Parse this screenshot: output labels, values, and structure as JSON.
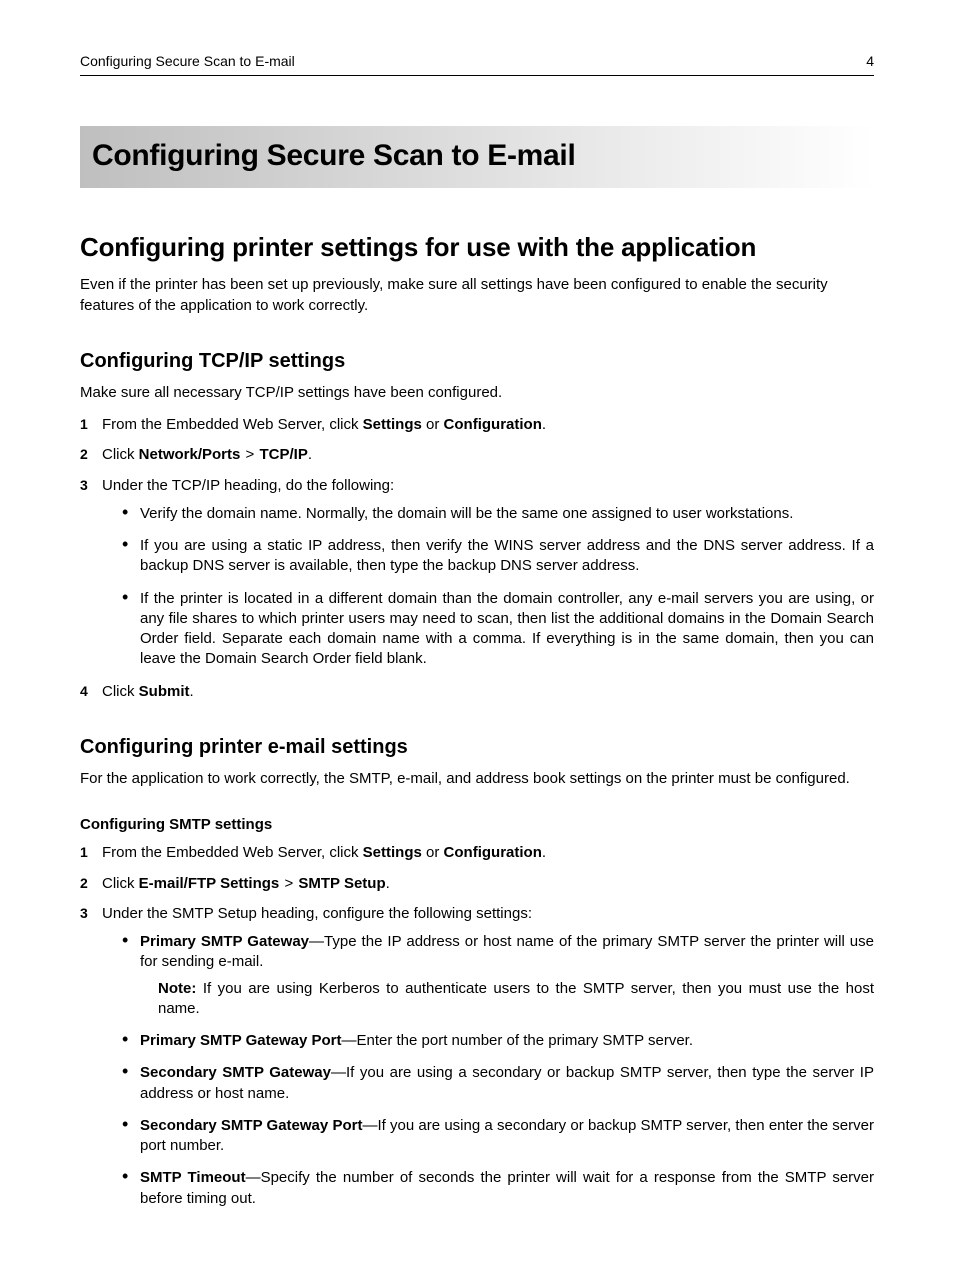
{
  "header": {
    "left": "Configuring Secure Scan to E-mail",
    "right": "4"
  },
  "title": "Configuring Secure Scan to E-mail",
  "s1": {
    "h2": "Configuring printer settings for use with the application",
    "intro": "Even if the printer has been set up previously, make sure all settings have been configured to enable the security features of the application to work correctly."
  },
  "tcpip": {
    "h3": "Configuring TCP/IP settings",
    "intro": "Make sure all necessary TCP/IP settings have been configured.",
    "step1_pre": "From the Embedded Web Server, click ",
    "step1_b1": "Settings",
    "step1_mid": " or ",
    "step1_b2": "Configuration",
    "step1_post": ".",
    "step2_pre": "Click ",
    "step2_b1": "Network/Ports",
    "step2_b2": "TCP/IP",
    "step2_post": ".",
    "step3": "Under the TCP/IP heading, do the following:",
    "b1": "Verify the domain name. Normally, the domain will be the same one assigned to user workstations.",
    "b2": "If you are using a static IP address, then verify the WINS server address and the DNS server address. If a backup DNS server is available, then type the backup DNS server address.",
    "b3": "If the printer is located in a different domain than the domain controller, any e‑mail servers you are using, or any file shares to which printer users may need to scan, then list the additional domains in the Domain Search Order field. Separate each domain name with a comma. If everything is in the same domain, then you can leave the Domain Search Order field blank.",
    "step4_pre": "Click ",
    "step4_b": "Submit",
    "step4_post": "."
  },
  "email": {
    "h3": "Configuring printer e‑mail settings",
    "intro": "For the application to work correctly, the SMTP, e‑mail, and address book settings on the printer must be configured.",
    "h4": "Configuring SMTP settings",
    "step1_pre": "From the Embedded Web Server, click ",
    "step1_b1": "Settings",
    "step1_mid": " or ",
    "step1_b2": "Configuration",
    "step1_post": ".",
    "step2_pre": "Click ",
    "step2_b1": "E‑mail/FTP Settings",
    "step2_b2": "SMTP Setup",
    "step2_post": ".",
    "step3": "Under the SMTP Setup heading, configure the following settings:",
    "i1_b": "Primary SMTP Gateway",
    "i1_t": "—Type the IP address or host name of the primary SMTP server the printer will use for sending e‑mail.",
    "note_b": "Note:",
    "note_t": " If you are using Kerberos to authenticate users to the SMTP server, then you must use the host name.",
    "i2_b": "Primary SMTP Gateway Port",
    "i2_t": "—Enter the port number of the primary SMTP server.",
    "i3_b": "Secondary SMTP Gateway",
    "i3_t": "—If you are using a secondary or backup SMTP server, then type the server IP address or host name.",
    "i4_b": "Secondary SMTP Gateway Port",
    "i4_t": "—If you are using a secondary or backup SMTP server, then enter the server port number.",
    "i5_b": "SMTP Timeout",
    "i5_t": "—Specify the number of seconds the printer will wait for a response from the SMTP server before timing out."
  },
  "nums": {
    "n1": "1",
    "n2": "2",
    "n3": "3",
    "n4": "4"
  },
  "sym": {
    "chevron": ">"
  }
}
